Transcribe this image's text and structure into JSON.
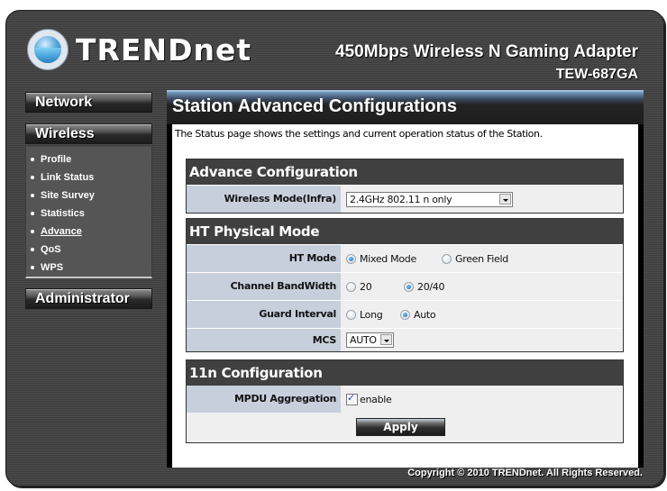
{
  "header": {
    "brand": "TRENDnet",
    "product_name": "450Mbps Wireless N Gaming Adapter",
    "model": "TEW-687GA"
  },
  "sidebar": {
    "network_label": "Network",
    "wireless_label": "Wireless",
    "administrator_label": "Administrator",
    "wireless_items": [
      {
        "label": "Profile",
        "active": false
      },
      {
        "label": "Link Status",
        "active": false
      },
      {
        "label": "Site Survey",
        "active": false
      },
      {
        "label": "Statistics",
        "active": false
      },
      {
        "label": "Advance",
        "active": true
      },
      {
        "label": "QoS",
        "active": false
      },
      {
        "label": "WPS",
        "active": false
      }
    ]
  },
  "page": {
    "title": "Station Advanced Configurations",
    "description": "The Status page shows the settings and current operation status of the Station."
  },
  "advance_config": {
    "header": "Advance Configuration",
    "wireless_mode_label": "Wireless Mode(Infra)",
    "wireless_mode_value": "2.4GHz 802.11 n only"
  },
  "ht_physical": {
    "header": "HT Physical Mode",
    "ht_mode_label": "HT Mode",
    "ht_mode_options": [
      "Mixed Mode",
      "Green Field"
    ],
    "ht_mode_selected": "Mixed Mode",
    "bandwidth_label": "Channel BandWidth",
    "bandwidth_options": [
      "20",
      "20/40"
    ],
    "bandwidth_selected": "20/40",
    "guard_label": "Guard Interval",
    "guard_options": [
      "Long",
      "Auto"
    ],
    "guard_selected": "Auto",
    "mcs_label": "MCS",
    "mcs_value": "AUTO"
  },
  "n11_config": {
    "header": "11n Configuration",
    "mpdu_label": "MPDU Aggregation",
    "mpdu_option": "enable",
    "mpdu_checked": true,
    "apply_label": "Apply"
  },
  "footer": {
    "copyright": "Copyright © 2010 TRENDnet. All Rights Reserved."
  }
}
